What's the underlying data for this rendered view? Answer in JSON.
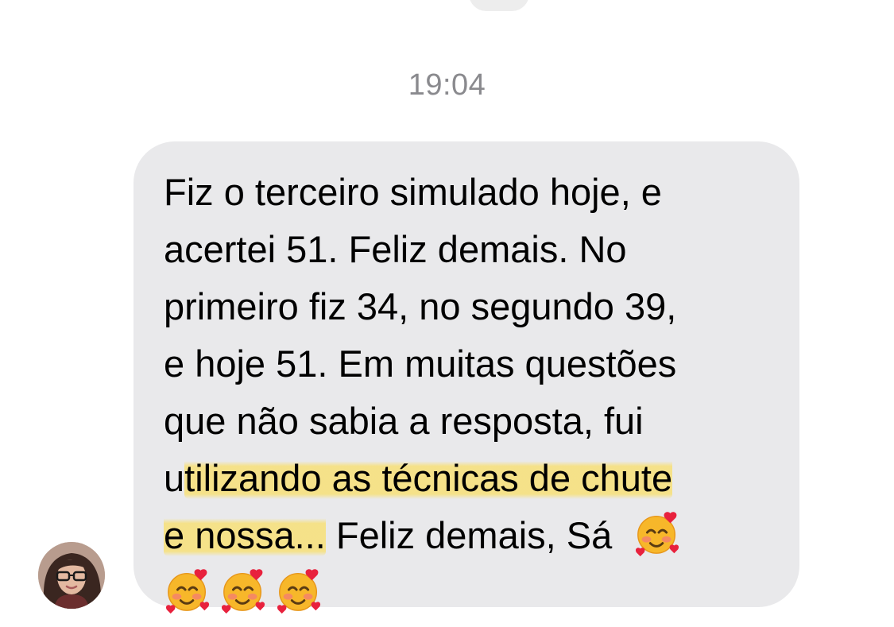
{
  "conversation": {
    "timestamp": "19:04"
  },
  "message": {
    "lines": [
      "Fiz o terceiro simulado hoje, e",
      "acertei 51. Feliz demais. No",
      "primeiro fiz 34, no segundo 39,",
      "e hoje 51. Em muitas questões",
      "que não sabia a resposta, fui"
    ],
    "line6_prefix": "u",
    "line6_highlight": "tilizando as técnicas de chute",
    "line7_highlight": "e nossa...",
    "line7_rest": " Feliz demais, Sá",
    "emoji": [
      "smiling-face-with-hearts",
      "smiling-face-with-hearts",
      "smiling-face-with-hearts",
      "smiling-face-with-hearts"
    ],
    "highlight_color": "#f7e078",
    "bubble_color": "#e9e9eb"
  },
  "sender": {
    "avatar": "profile-photo-woman-with-glasses"
  }
}
